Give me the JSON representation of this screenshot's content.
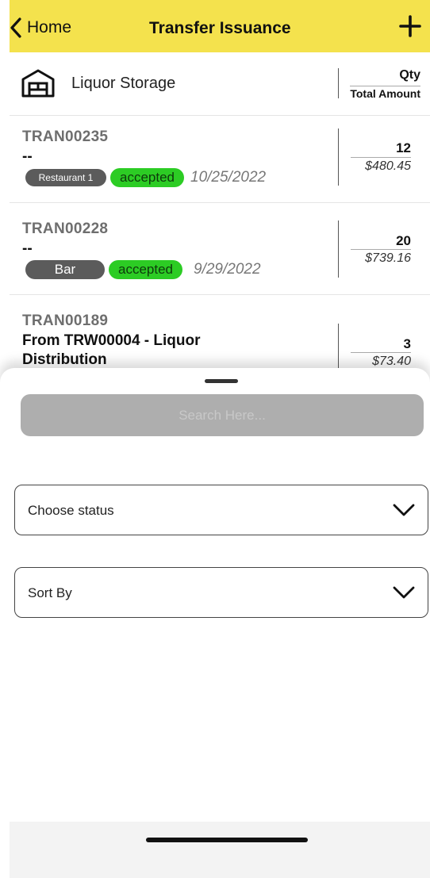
{
  "header": {
    "back_label": "Home",
    "title": "Transfer Issuance",
    "accent_color": "#f4e24d"
  },
  "store": {
    "icon": "warehouse-icon",
    "name": "Liquor Storage",
    "qty_header": "Qty",
    "total_header": "Total Amount"
  },
  "transfers": [
    {
      "id": "TRAN00235",
      "description": "--",
      "location": "Restaurant 1",
      "status": "accepted",
      "date": "10/25/2022",
      "qty": "12",
      "amount": "$480.45"
    },
    {
      "id": "TRAN00228",
      "description": "--",
      "location": "Bar",
      "status": "accepted",
      "date": "9/29/2022",
      "qty": "20",
      "amount": "$739.16"
    },
    {
      "id": "TRAN00189",
      "description_line1": "From TRW00004 - Liquor",
      "description_line2": "Distribution",
      "qty": "3",
      "amount": "$73.40"
    }
  ],
  "filter_sheet": {
    "search_placeholder": "Search Here...",
    "status_label": "Choose status",
    "sort_label": "Sort By"
  },
  "colors": {
    "status_accepted": "#2ccc24",
    "location_badge": "#5b5b5b"
  }
}
